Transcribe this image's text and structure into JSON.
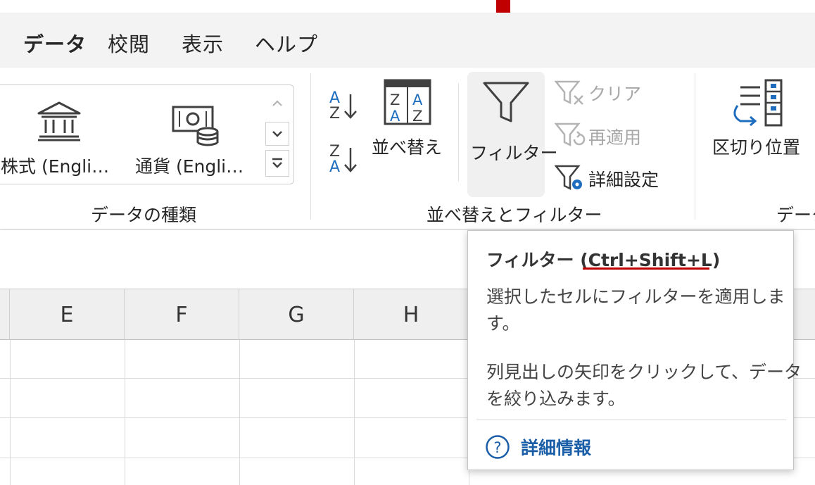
{
  "tabs": [
    {
      "label": "データ",
      "active": true
    },
    {
      "label": "校閲",
      "active": false
    },
    {
      "label": "表示",
      "active": false
    },
    {
      "label": "ヘルプ",
      "active": false
    }
  ],
  "ribbon": {
    "data_types": {
      "items": [
        {
          "label": "株式 (Engli…",
          "icon": "bank-icon"
        },
        {
          "label": "通貨 (Engli…",
          "icon": "currency-icon"
        }
      ],
      "group_label": "データの種類"
    },
    "sort_filter": {
      "sort_label": "並べ替え",
      "filter_label": "フィルター",
      "clear_label": "クリア",
      "reapply_label": "再適用",
      "advanced_label": "詳細設定",
      "group_label": "並べ替えとフィルター"
    },
    "data_tools": {
      "text_to_columns_label": "区切り位置",
      "group_label_partial": "データ"
    }
  },
  "sheet": {
    "columns": [
      "E",
      "F",
      "G",
      "H"
    ]
  },
  "tooltip": {
    "title": "フィルター (Ctrl+Shift+L)",
    "description_lines": [
      "選択したセルにフィルターを適用しま",
      "す。"
    ],
    "detail_lines": [
      "列見出しの矢印をクリックして、データ",
      "を絞り込みます。"
    ],
    "more_info": "詳細情報"
  },
  "colors": {
    "arrow": "#c00000",
    "active_tab_underline": "#1e7145",
    "link": "#1b5ea8",
    "sort_blue": "#1f6dbf"
  }
}
